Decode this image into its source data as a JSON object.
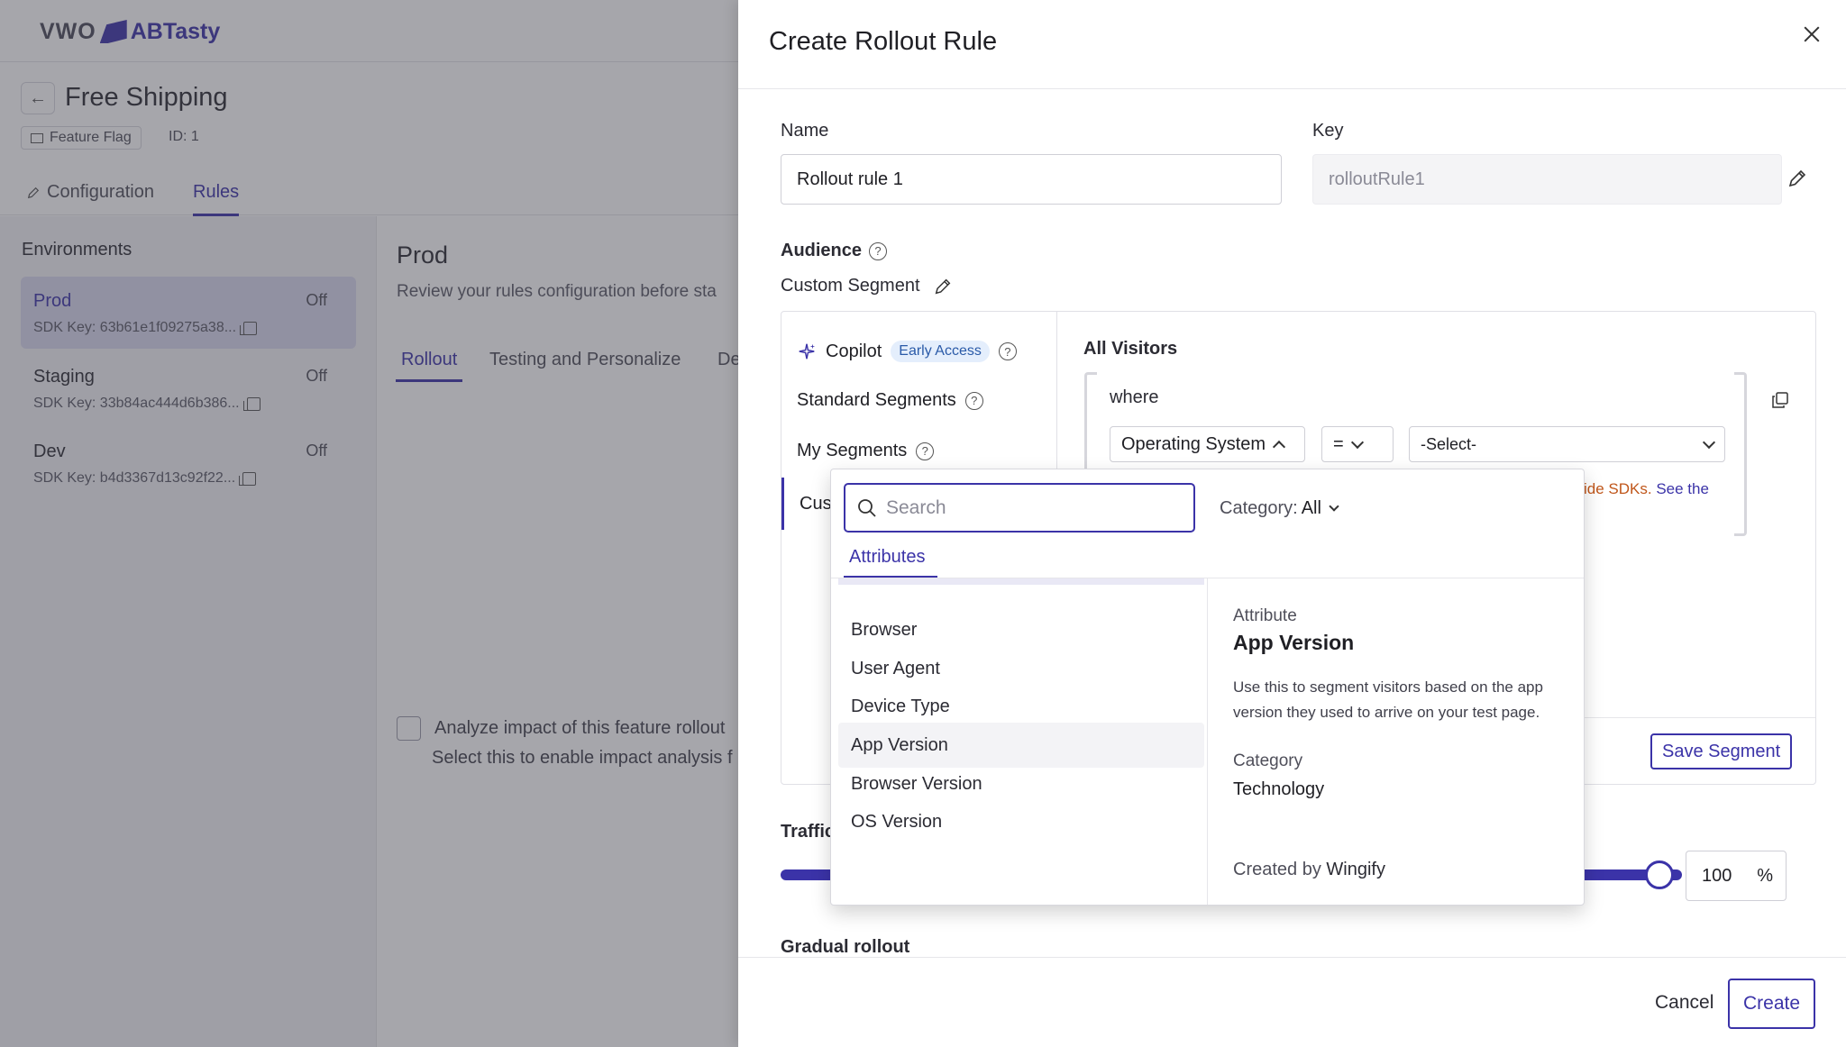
{
  "app": {
    "logo_vwo": "VWO",
    "logo_abtasty": "ABTasty"
  },
  "feature": {
    "title": "Free Shipping",
    "type_label": "Feature Flag",
    "id_label": "ID: 1"
  },
  "top_tabs": [
    {
      "label": "Configuration"
    },
    {
      "label": "Rules"
    }
  ],
  "environments": {
    "heading": "Environments",
    "items": [
      {
        "name": "Prod",
        "status": "Off",
        "sdk_key": "SDK Key: 63b61e1f09275a38..."
      },
      {
        "name": "Staging",
        "status": "Off",
        "sdk_key": "SDK Key: 33b84ac444d6b386..."
      },
      {
        "name": "Dev",
        "status": "Off",
        "sdk_key": "SDK Key: b4d3367d13c92f22..."
      }
    ]
  },
  "main": {
    "title": "Prod",
    "subtitle": "Review your rules configuration before sta",
    "sub_tabs": [
      {
        "label": "Rollout"
      },
      {
        "label": "Testing and Personalize"
      },
      {
        "label": "De"
      }
    ],
    "analyze_label": "Analyze impact of this feature rollout",
    "analyze_sub": "Select this to enable impact analysis f"
  },
  "drawer": {
    "title": "Create Rollout Rule",
    "name_label": "Name",
    "name_value": "Rollout rule 1",
    "key_label": "Key",
    "key_value": "rolloutRule1",
    "audience_label": "Audience",
    "segment_label": "Custom Segment",
    "segment_options": {
      "copilot": "Copilot",
      "early_access": "Early Access",
      "standard": "Standard Segments",
      "my": "My Segments",
      "custom": "Cus"
    },
    "all_visitors": "All Visitors",
    "where": "where",
    "condition": {
      "attribute": "Operating System",
      "operator": "=",
      "value_placeholder": "-Select-"
    },
    "warning_text": "ide SDKs.",
    "warning_link": "See the",
    "save_segment": "Save Segment",
    "traffic_label": "Traffic",
    "traffic_value": "100",
    "traffic_unit": "%",
    "traffic_fraction": 1.0,
    "gradual_label": "Gradual rollout",
    "cancel": "Cancel",
    "create": "Create"
  },
  "popup": {
    "search_placeholder": "Search",
    "category_prefix": "Category:",
    "category_value": "All",
    "tab_label": "Attributes",
    "items": [
      {
        "label": "Browser"
      },
      {
        "label": "User Agent"
      },
      {
        "label": "Device Type"
      },
      {
        "label": "App Version"
      },
      {
        "label": "Browser Version"
      },
      {
        "label": "OS Version"
      }
    ],
    "detail": {
      "attr_label": "Attribute",
      "attr_name": "App Version",
      "description": "Use this to segment visitors based on the app version they used to arrive on your test page.",
      "category_label": "Category",
      "category_value": "Technology",
      "created_prefix": "Created by",
      "created_by": "Wingify"
    }
  },
  "colors": {
    "accent": "#3b33a8",
    "warning": "#c0561a"
  }
}
